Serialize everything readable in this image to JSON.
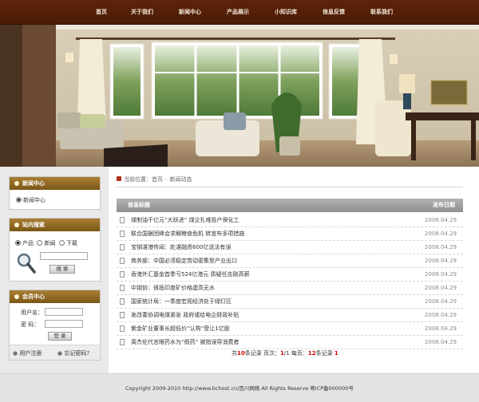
{
  "nav": [
    "首页",
    "关于我们",
    "新闻中心",
    "产品展示",
    "小知识库",
    "信息反馈",
    "联系我们"
  ],
  "sidebar": {
    "news": {
      "title": "新闻中心",
      "item": "新闻中心"
    },
    "search": {
      "title": "站内搜索",
      "options": [
        "产品",
        "新闻",
        "下载"
      ],
      "selected": "产品",
      "button": "搜 索"
    },
    "member": {
      "title": "会员中心",
      "username_label": "用户名：",
      "password_label": "密  码：",
      "login_button": "登 录",
      "register_link": "用户注册",
      "forgot_link": "忘记密码?"
    }
  },
  "breadcrumb": {
    "prefix": "当前位置：",
    "home": "首页",
    "sep": "-",
    "current": "新闻动态"
  },
  "table": {
    "col_title": "信息标题",
    "col_date": "发布日期",
    "rows": [
      {
        "title": "煤制油千亿元“大跃进” 煤企扎堆投产保化工",
        "date": "2008.04.29"
      },
      {
        "title": "联合国据团峰会求解粮食危机 转宣布多项措施",
        "date": "2008.04.29"
      },
      {
        "title": "宝钢湛港传闻：赴湛融资600亿说法有误",
        "date": "2008.04.29"
      },
      {
        "title": "商务部：中国必须稳定劳动密集型产业出口",
        "date": "2008.04.29"
      },
      {
        "title": "香港外汇基金首季亏524亿港元 质疑任志刚高薪",
        "date": "2008.04.29"
      },
      {
        "title": "中钢协：很抵印度矿价格虚高无水",
        "date": "2008.04.29"
      },
      {
        "title": "国家统计局：一季度宏观经济处于绿灯区",
        "date": "2008.04.29"
      },
      {
        "title": "发改委协调电煤紧张 政府或给电企财政补贴",
        "date": "2008.04.29"
      },
      {
        "title": "紫金矿业董事长超低价“认购”受让1亿股",
        "date": "2008.04.29"
      },
      {
        "title": "周杰伦代言眼药水为“假药” 被指误导消费者",
        "date": "2008.04.29"
      }
    ]
  },
  "pager": {
    "t1": "共",
    "total": "10",
    "t2": "条记录  页次：",
    "page": "1",
    "slash": "/",
    "pages": "1",
    "t3": "  每页：",
    "per": "12",
    "t4": "条记录   ",
    "current": "1"
  },
  "footer": "Copyright 2009-2010 http://www.bchost.cn/百川网络 All Rights Reserve 粤ICP备000000号",
  "colors": {
    "nav": "#4a1b06",
    "box_header": "#8f6722",
    "table_header": "#a0a0a0",
    "pager_red": "#d10000"
  }
}
